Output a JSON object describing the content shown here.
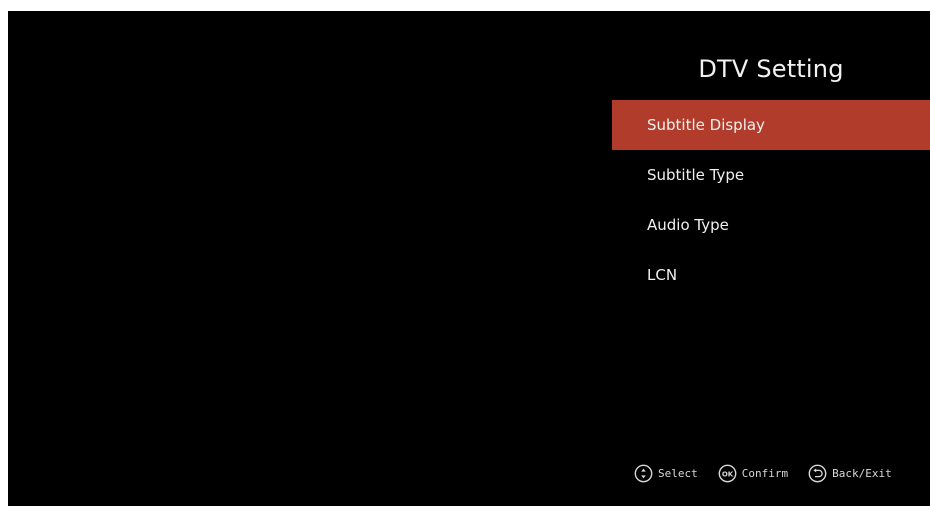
{
  "menu": {
    "title": "DTV Setting",
    "selected_index": 0,
    "items": [
      {
        "label": "Subtitle Display"
      },
      {
        "label": "Subtitle Type"
      },
      {
        "label": "Audio Type"
      },
      {
        "label": "LCN"
      }
    ]
  },
  "hints": {
    "select": {
      "icon": "up-down-icon",
      "label": "Select"
    },
    "confirm": {
      "icon": "ok-icon",
      "label": "Confirm",
      "icon_text": "OK"
    },
    "back": {
      "icon": "back-icon",
      "label": "Back/Exit"
    }
  },
  "colors": {
    "background": "#000000",
    "highlight": "#b23c2c",
    "text": "#f0f0f0"
  }
}
